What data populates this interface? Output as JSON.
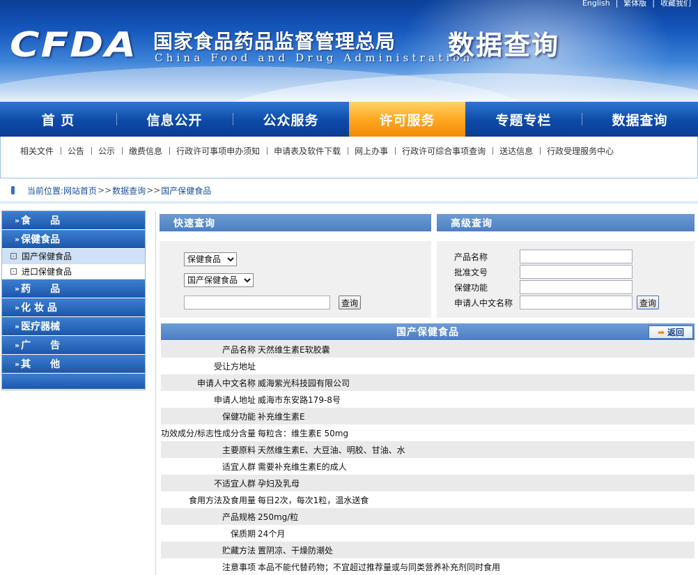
{
  "header": {
    "top_links": [
      "English",
      "|",
      "繁体版",
      "|",
      "收藏我们"
    ],
    "logo": "CFDA",
    "agency_cn": "国家食品药品监督管理总局",
    "agency_en": "China Food and Drug Administration",
    "site_title": "数据查询"
  },
  "main_nav": [
    "首 页",
    "信息公开",
    "公众服务",
    "许可服务",
    "专题专栏",
    "数据查询"
  ],
  "main_nav_active_index": 3,
  "sub_nav": [
    "相关文件",
    "公告",
    "公示",
    "缴费信息",
    "行政许可事项申办须知",
    "申请表及软件下载",
    "网上办事",
    "行政许可综合事项查询",
    "送达信息",
    "行政受理服务中心"
  ],
  "breadcrumb": {
    "prefix": "当前位置:",
    "items": [
      "网站首页",
      "数据查询",
      "国产保健食品"
    ],
    "separator": ">>"
  },
  "sidebar": {
    "food": "食　　品",
    "health_food": "保健食品",
    "sub_domestic": "国产保健食品",
    "sub_imported": "进口保健食品",
    "drugs": "药　　品",
    "cosmetics": "化 妆 品",
    "devices": "医疗器械",
    "ads": "广　　告",
    "other": "其　　他"
  },
  "quick_search": {
    "title": "快速查询",
    "category_value": "保健食品",
    "subcategory_value": "国产保健食品",
    "keyword_value": "",
    "button": "查询"
  },
  "advanced_search": {
    "title": "高级查询",
    "label_product": "产品名称",
    "label_approval": "批准文号",
    "label_function": "保健功能",
    "label_applicant": "申请人中文名称",
    "button": "查询"
  },
  "detail": {
    "title": "国产保健食品",
    "back_button": "返回",
    "rows": [
      {
        "key": "产品名称",
        "value": "天然维生素E软胶囊"
      },
      {
        "key": "受让方地址",
        "value": ""
      },
      {
        "key": "申请人中文名称",
        "value": "威海紫光科技园有限公司"
      },
      {
        "key": "申请人地址",
        "value": "威海市东安路179-8号"
      },
      {
        "key": "保健功能",
        "value": "补充维生素E"
      },
      {
        "key": "功效成分/标志性成分含量",
        "value": "每粒含：维生素E 50mg"
      },
      {
        "key": "主要原料",
        "value": "天然维生素E、大豆油、明胶、甘油、水"
      },
      {
        "key": "适宜人群",
        "value": "需要补充维生素E的成人"
      },
      {
        "key": "不适宜人群",
        "value": "孕妇及乳母"
      },
      {
        "key": "食用方法及食用量",
        "value": "每日2次，每次1粒，温水送食"
      },
      {
        "key": "产品规格",
        "value": "250mg/粒"
      },
      {
        "key": "保质期",
        "value": "24个月"
      },
      {
        "key": "贮藏方法",
        "value": "置阴凉、干燥防潮处"
      },
      {
        "key": "注意事项",
        "value": "本品不能代替药物；不宜超过推荐量或与同类营养补充剂同时食用"
      }
    ]
  }
}
